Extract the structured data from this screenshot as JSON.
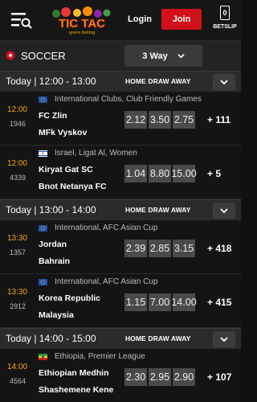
{
  "header": {
    "logo_text": "TIC TAC",
    "logo_sub": "sports betting",
    "login_label": "Login",
    "join_label": "Join",
    "betslip_count": "0",
    "betslip_label": "BETSLIP"
  },
  "sport": {
    "name": "SOCCER",
    "market": "3 Way"
  },
  "groups": [
    {
      "time": "Today | 12:00 - 13:00",
      "cols": "HOME DRAW AWAY",
      "events": [
        {
          "time": "12:00",
          "code": "1946",
          "flag": "eu",
          "league": "International Clubs, Club Friendly Games",
          "home": "FC Zlin",
          "away": "MFk Vyskov",
          "odds": [
            "2.12",
            "3.50",
            "2.75"
          ],
          "more": "+ 111"
        },
        {
          "time": "12:00",
          "code": "4339",
          "flag": "il",
          "league": "Israel, Ligat Al, Women",
          "home": "Kiryat Gat SC",
          "away": "Bnot Netanya FC",
          "odds": [
            "1.04",
            "8.80",
            "15.00"
          ],
          "more": "+ 5"
        }
      ]
    },
    {
      "time": "Today | 13:00 - 14:00",
      "cols": "HOME DRAW AWAY",
      "events": [
        {
          "time": "13:30",
          "code": "1357",
          "flag": "eu",
          "league": "International, AFC Asian Cup",
          "home": "Jordan",
          "away": "Bahrain",
          "odds": [
            "2.39",
            "2.85",
            "3.15"
          ],
          "more": "+ 418"
        },
        {
          "time": "13:30",
          "code": "2912",
          "flag": "eu",
          "league": "International, AFC Asian Cup",
          "home": "Korea Republic",
          "away": "Malaysia",
          "odds": [
            "1.15",
            "7.00",
            "14.00"
          ],
          "more": "+ 415"
        }
      ]
    },
    {
      "time": "Today | 14:00 - 15:00",
      "cols": "HOME DRAW AWAY",
      "events": [
        {
          "time": "14:00",
          "code": "4564",
          "flag": "et",
          "league": "Ethiopia, Premier League",
          "home": "Ethiopian Medhin",
          "away": "Shashemene Kene",
          "odds": [
            "2.30",
            "2.95",
            "2.90"
          ],
          "more": "+ 107"
        }
      ]
    }
  ],
  "colors": {
    "accent": "#d0101b",
    "time": "#f2a71c",
    "odds_bg": "#4a4a4a"
  }
}
